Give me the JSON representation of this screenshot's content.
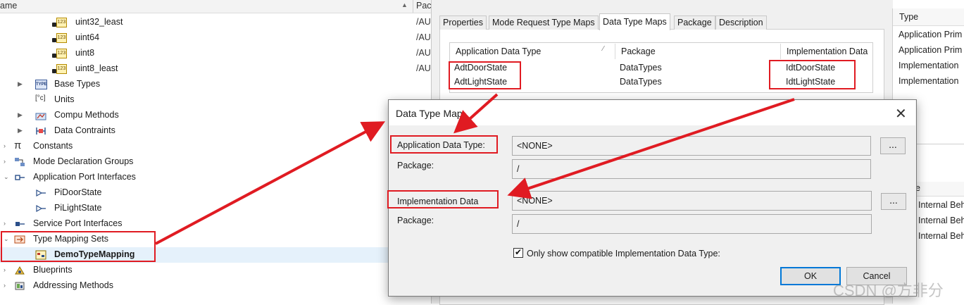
{
  "tree": {
    "header_name": "ame",
    "header_path": "Pac",
    "rows": [
      {
        "label": "uint32_least",
        "path": "/AUT"
      },
      {
        "label": "uint64",
        "path": "/AUT"
      },
      {
        "label": "uint8",
        "path": "/AUT"
      },
      {
        "label": "uint8_least",
        "path": "/AUT"
      },
      {
        "label": "Base Types"
      },
      {
        "label": "Units",
        "icon_text": "[°c]"
      },
      {
        "label": "Compu Methods"
      },
      {
        "label": "Data Contraints"
      },
      {
        "label": "Constants",
        "icon_text": "π"
      },
      {
        "label": "Mode Declaration Groups"
      },
      {
        "label": "Application Port Interfaces"
      },
      {
        "label": "PiDoorState"
      },
      {
        "label": "PiLightState"
      },
      {
        "label": "Service Port Interfaces"
      },
      {
        "label": "Type Mapping Sets"
      },
      {
        "label": "DemoTypeMapping"
      },
      {
        "label": "Blueprints"
      },
      {
        "label": "Addressing Methods"
      }
    ]
  },
  "props": {
    "tabs": [
      "Properties",
      "Mode Request Type Maps",
      "Data Type Maps",
      "Package",
      "Description"
    ],
    "active_tab": "Data Type Maps",
    "table": {
      "headers": [
        "Application Data Type",
        "Package",
        "Implementation Data"
      ],
      "rows": [
        [
          "AdtDoorState",
          "DataTypes",
          "IdtDoorState"
        ],
        [
          "AdtLightState",
          "DataTypes",
          "IdtLightState"
        ]
      ]
    }
  },
  "right_panel": {
    "header": "Type",
    "rows": [
      "Application Prim",
      "Application Prim",
      "Implementation",
      "Implementation"
    ],
    "header2": "e",
    "rows2": [
      "Internal Beh",
      "Internal Beh",
      "Internal Beh"
    ]
  },
  "dialog": {
    "title": "Data Type Map",
    "close": "✕",
    "app_label": "Application Data Type:",
    "app_value": "<NONE>",
    "package_label_1": "Package:",
    "package_value_1": "/",
    "impl_label": "Implementation Data",
    "impl_value": "<NONE>",
    "package_label_2": "Package:",
    "package_value_2": "/",
    "browse": "...",
    "checkbox_label": "Only show compatible Implementation Data Type:",
    "checkbox_checked": true,
    "ok": "OK",
    "cancel": "Cancel"
  },
  "watermark": "CSDN @方非分",
  "colors": {
    "annotation": "#e01b22",
    "selection": "#e5f1fb",
    "default_button": "#0078d7"
  }
}
